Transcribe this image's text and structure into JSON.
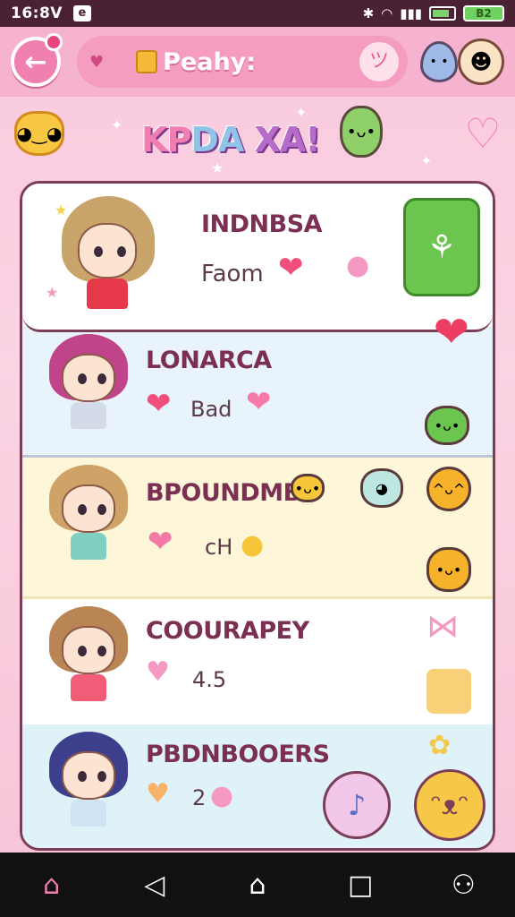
{
  "status_bar": {
    "time": "16:8V",
    "notification": "e",
    "battery_label": "B2"
  },
  "header": {
    "back_glyph": "←",
    "title": "Peahy:",
    "heart_glyph": "♥",
    "face_glyph": "ツ",
    "profile_glyph": "☻"
  },
  "banner": {
    "logo_a": "KP",
    "logo_b": "DA ",
    "logo_c": "XA!"
  },
  "list": {
    "rows": [
      {
        "name": "INDNBSA",
        "value": "Faom"
      },
      {
        "name": "LONARCA",
        "value": "Bad"
      },
      {
        "name": "BPOUNDMB",
        "value": "cH"
      },
      {
        "name": "COOURAPEY",
        "value": "4.5"
      },
      {
        "name": "PBDNBOOERS",
        "value": "2"
      }
    ]
  },
  "colors": {
    "accent_pink": "#f080ad",
    "share_green": "#6cc54e",
    "heart_red": "#ee3d62",
    "outline": "#7a3e58"
  },
  "icons": {
    "share": "share-icon",
    "music": "music-note-icon",
    "emoji": "happy-face-icon"
  },
  "navbar": {
    "home": "⌂",
    "back": "◁",
    "circle": "⌂",
    "recent": "□",
    "user": "⚇"
  }
}
